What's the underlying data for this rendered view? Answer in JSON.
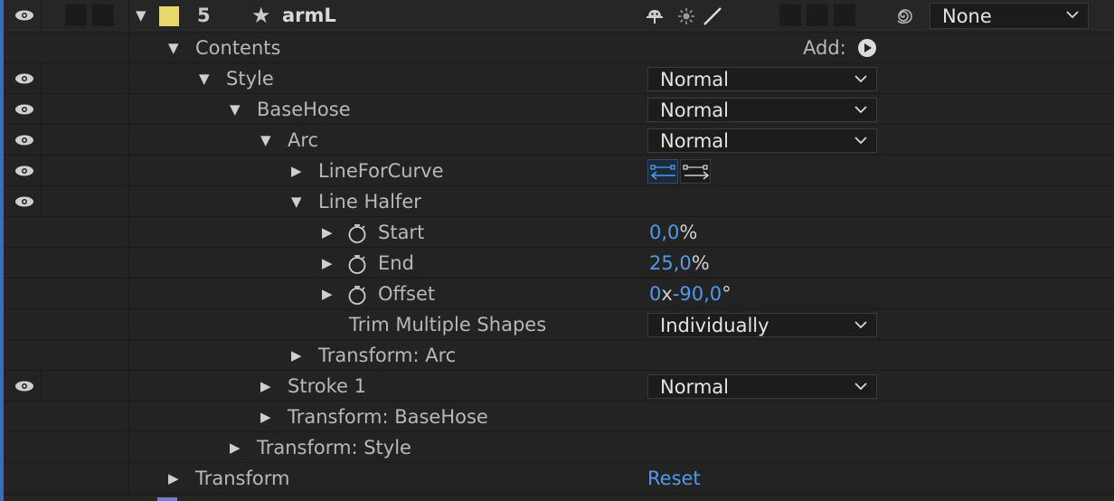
{
  "layer": {
    "number": "5",
    "name": "armL",
    "label_color": "#e8d86a",
    "parent_value": "None",
    "switch_icons": [
      "shy-icon",
      "collapse-icon",
      "quality-icon"
    ]
  },
  "rows": {
    "contents": "Contents",
    "add_label": "Add:",
    "style": "Style",
    "basehose": "BaseHose",
    "arc": "Arc",
    "lineforcurve": "LineForCurve",
    "linehalfer": "Line Halfer",
    "start": "Start",
    "end": "End",
    "offset": "Offset",
    "trim_multiple": "Trim Multiple Shapes",
    "transform_arc": "Transform: Arc",
    "stroke1": "Stroke 1",
    "transform_basehose": "Transform: BaseHose",
    "transform_style": "Transform: Style",
    "transform": "Transform"
  },
  "values": {
    "style_blend": "Normal",
    "basehose_blend": "Normal",
    "arc_blend": "Normal",
    "stroke1_blend": "Normal",
    "start_num": "0,0",
    "start_unit": "%",
    "end_num": "25,0",
    "end_unit": "%",
    "offset_rev": "0",
    "offset_x": "x",
    "offset_num": "-90,0",
    "offset_unit": "°",
    "trim_mode": "Individually",
    "transform_reset": "Reset"
  },
  "colors": {
    "accent_blue": "#4f9be8",
    "background": "#232323",
    "layer_row": "#262626"
  }
}
